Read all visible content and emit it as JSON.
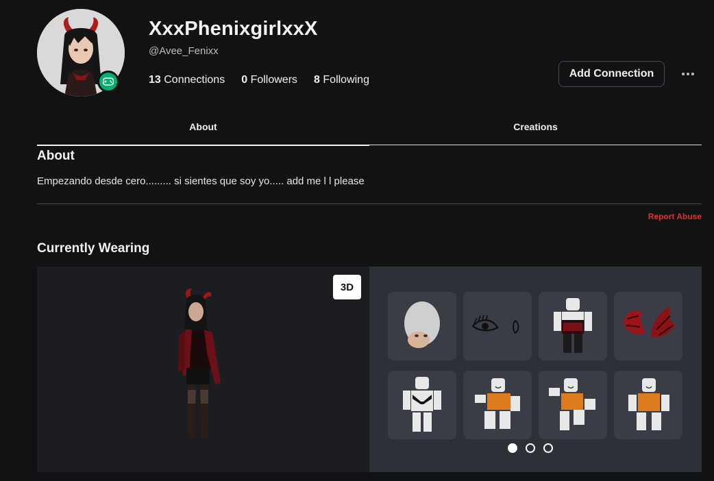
{
  "profile": {
    "display_name": "XxxPhenixgirlxxX",
    "username": "@Avee_Fenixx",
    "avatar_icon": "avatar-headshot",
    "presence_icon": "gamepad-icon",
    "presence_color": "#00b06f"
  },
  "stats": {
    "connections_count": "13",
    "connections_label": "Connections",
    "followers_count": "0",
    "followers_label": "Followers",
    "following_count": "8",
    "following_label": "Following"
  },
  "actions": {
    "add_connection_label": "Add Connection",
    "more_icon": "more-horizontal-icon"
  },
  "tabs": [
    {
      "label": "About",
      "active": true
    },
    {
      "label": "Creations",
      "active": false
    }
  ],
  "about": {
    "title": "About",
    "text": "Empezando desde cero......... si sientes que soy yo..... add me l l  please",
    "report_label": "Report Abuse",
    "report_color": "#e0302b"
  },
  "wearing": {
    "title": "Currently Wearing",
    "view_3d_label": "3D",
    "items": [
      {
        "icon": "head-icon"
      },
      {
        "icon": "eyes-icon"
      },
      {
        "icon": "outfit-icon"
      },
      {
        "icon": "horns-icon"
      },
      {
        "icon": "top-icon"
      },
      {
        "icon": "animation-icon"
      },
      {
        "icon": "animation-icon"
      },
      {
        "icon": "animation-icon"
      }
    ],
    "pages": 3,
    "current_page": 1
  }
}
